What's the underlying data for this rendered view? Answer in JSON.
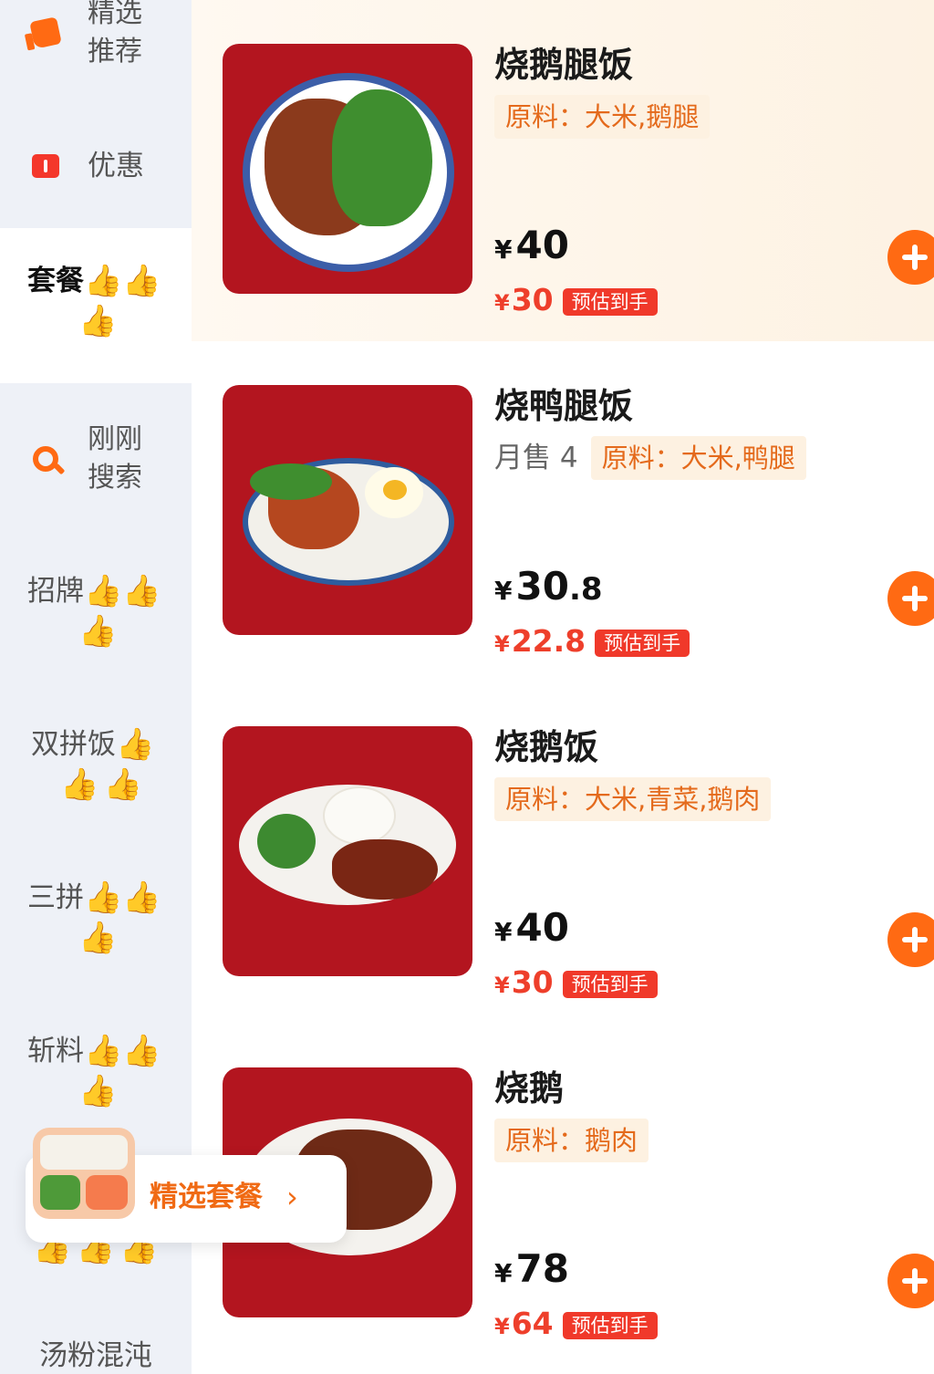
{
  "sidebar": {
    "featured": "精选推荐",
    "featured_line1": "精选",
    "featured_line2": "推荐",
    "discount": "优惠",
    "combo": "套餐",
    "recent_search_line1": "刚刚",
    "recent_search_line2": "搜索",
    "signature": "招牌",
    "double": "双拼饭",
    "triple": "三拼",
    "chopped": "斩料",
    "soup": "汤粉混沌",
    "thumbs_emoji": "👍"
  },
  "popup": {
    "label": "精选套餐",
    "chevron": "›"
  },
  "products": [
    {
      "name": "烧鹅腿饭",
      "sales": "",
      "ingredients": "原料：大米,鹅腿",
      "yen": "¥",
      "price_int": "40",
      "price_dec": "",
      "est_price": "30",
      "est_tag": "预估到手"
    },
    {
      "name": "烧鸭腿饭",
      "sales": "月售 4",
      "ingredients": "原料：大米,鸭腿",
      "yen": "¥",
      "price_int": "30",
      "price_dec": ".8",
      "est_price": "22.8",
      "est_tag": "预估到手"
    },
    {
      "name": "烧鹅饭",
      "sales": "",
      "ingredients": "原料：大米,青菜,鹅肉",
      "yen": "¥",
      "price_int": "40",
      "price_dec": "",
      "est_price": "30",
      "est_tag": "预估到手"
    },
    {
      "name": "烧鹅",
      "sales": "",
      "ingredients": "原料：鹅肉",
      "yen": "¥",
      "price_int": "78",
      "price_dec": "",
      "est_price": "64",
      "est_tag": "预估到手"
    }
  ],
  "colors": {
    "accent": "#ff6a13",
    "discount_red": "#f0392a",
    "image_bg": "#b3151f"
  }
}
